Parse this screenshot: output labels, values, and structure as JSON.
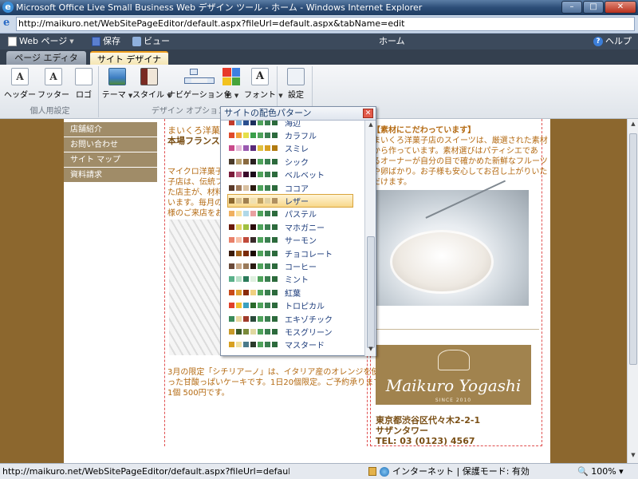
{
  "window": {
    "title": "Microsoft Office Live Small Business Web デザイン ツール - ホーム - Windows Internet Explorer",
    "buttons": {
      "minimize": "–",
      "maximize": "□",
      "close": "✕"
    }
  },
  "address": {
    "url": "http://maikuro.net/WebSitePageEditor/default.aspx?fileUrl=default.aspx&tabName=edit"
  },
  "appbar": {
    "web_page": "Web ページ",
    "save": "保存",
    "view": "ビュー",
    "page_name": "ホーム",
    "help": "ヘルプ"
  },
  "tabs": [
    {
      "label": "ページ エディタ",
      "active": false
    },
    {
      "label": "サイト デザイナ",
      "active": true
    }
  ],
  "ribbon": {
    "groups": [
      {
        "label": "個人用設定",
        "buttons": [
          {
            "label": "ヘッダー",
            "icon": "header-icon"
          },
          {
            "label": "フッター",
            "icon": "footer-icon"
          },
          {
            "label": "ロゴ",
            "icon": "logo-icon"
          }
        ]
      },
      {
        "label": "デザイン オプション",
        "buttons": [
          {
            "label": "テーマ",
            "icon": "theme-icon"
          },
          {
            "label": "スタイル",
            "icon": "style-icon"
          },
          {
            "label": "ナビゲーション",
            "icon": "navigation-icon"
          },
          {
            "label": "色",
            "icon": "color-icon"
          },
          {
            "label": "フォント",
            "icon": "font-icon"
          }
        ]
      },
      {
        "label": "",
        "buttons": [
          {
            "label": "設定",
            "icon": "settings-icon"
          }
        ]
      }
    ]
  },
  "site": {
    "nav": [
      "店舗紹介",
      "お問い合わせ",
      "サイト マップ",
      "資料請求"
    ],
    "main_heading_1": "まいくろ洋菓",
    "main_heading_2": "本場フランスの",
    "main_body": [
      "マイクロ洋菓子",
      "子店は、伝統フ",
      "た店主が、材料",
      "います。毎月の",
      "様のご来店をお"
    ],
    "main_footer": [
      "3月の限定「シチリアーノ」は、イタリア産のオレンジを使",
      "った甘酸っぱいケーキです。1日20個限定。ご予約承ります。",
      "1個 500円です。"
    ],
    "right_heading": "【素材にこだわっています】",
    "right_body": [
      "まいくろ洋菓子店のスイーツは、厳選された素材",
      "から作っています。素材選びはパティシエであ",
      "るオーナーが自分の目で確かめた新鮮なフルーツ",
      "や卵ばかり。お子様も安心してお召し上がりいた",
      "だけます。"
    ],
    "logo_text": "Maikuro Yogashi",
    "logo_since": "SINCE 2010",
    "contact": [
      "東京都渋谷区代々木2-2-1",
      "サザンタワー",
      "TEL: 03 (0123) 4567"
    ]
  },
  "popup": {
    "title": "サイトの配色パターン",
    "close": "✕",
    "selected": "レザー",
    "palettes": [
      {
        "name": "海辺",
        "colors": [
          "#c23a2a",
          "#7bb0d8",
          "#2a4f8f",
          "#1c2f5c",
          "#4fa35b",
          "#3a7f4f",
          "#2c6a3c"
        ]
      },
      {
        "name": "カラフル",
        "colors": [
          "#e04a2a",
          "#f2a33a",
          "#e5e04a",
          "#3a9f4a",
          "#4fa35b",
          "#3a7f4f",
          "#2c6a3c"
        ]
      },
      {
        "name": "スミレ",
        "colors": [
          "#c94a8a",
          "#e5b8d8",
          "#9a5ab0",
          "#5a2a7a",
          "#e0c040",
          "#d8a020",
          "#b07a10"
        ]
      },
      {
        "name": "シック",
        "colors": [
          "#4a3a2a",
          "#b8a070",
          "#8a6a40",
          "#2a2020",
          "#4fa35b",
          "#3a7f4f",
          "#2c6a3c"
        ]
      },
      {
        "name": "ベルベット",
        "colors": [
          "#7a1a3a",
          "#c26a8a",
          "#3a0a2a",
          "#1a0a1a",
          "#4fa35b",
          "#3a7f4f",
          "#2c6a3c"
        ]
      },
      {
        "name": "ココア",
        "colors": [
          "#5a3a2a",
          "#a07a5a",
          "#d8c0a0",
          "#2a1a10",
          "#4fa35b",
          "#3a7f4f",
          "#2c6a3c"
        ]
      },
      {
        "name": "レザー",
        "colors": [
          "#8c672e",
          "#d8c090",
          "#a08050",
          "#f0e0b0",
          "#c0a060",
          "#e0d0a0",
          "#b09060"
        ]
      },
      {
        "name": "パステル",
        "colors": [
          "#f0b060",
          "#f8e0a0",
          "#b0d8e8",
          "#e8a0a0",
          "#4fa35b",
          "#3a7f4f",
          "#2c6a3c"
        ]
      },
      {
        "name": "マホガニー",
        "colors": [
          "#6a1a0a",
          "#e0d060",
          "#a0c040",
          "#2a0a0a",
          "#4fa35b",
          "#3a7f4f",
          "#2c6a3c"
        ]
      },
      {
        "name": "サーモン",
        "colors": [
          "#e8806a",
          "#f8c0a8",
          "#c04a3a",
          "#3a2a2a",
          "#4fa35b",
          "#3a7f4f",
          "#2c6a3c"
        ]
      },
      {
        "name": "チョコレート",
        "colors": [
          "#3a1a0a",
          "#a0601a",
          "#7a2a0a",
          "#1a0a00",
          "#4fa35b",
          "#3a7f4f",
          "#2c6a3c"
        ]
      },
      {
        "name": "コーヒー",
        "colors": [
          "#6a4a3a",
          "#c8a888",
          "#9a7a5a",
          "#2a1a10",
          "#4fa35b",
          "#3a7f4f",
          "#2c6a3c"
        ]
      },
      {
        "name": "ミント",
        "colors": [
          "#5ab08a",
          "#b8e0c8",
          "#2a7a5a",
          "#e0f0e0",
          "#4fa35b",
          "#3a7f4f",
          "#2c6a3c"
        ]
      },
      {
        "name": "紅葉",
        "colors": [
          "#c84a1a",
          "#e0a030",
          "#8a2a0a",
          "#f0d080",
          "#4fa35b",
          "#3a7f4f",
          "#2c6a3c"
        ]
      },
      {
        "name": "トロピカル",
        "colors": [
          "#e0402a",
          "#f0c030",
          "#3aa0c0",
          "#2a6a2a",
          "#4fa35b",
          "#3a7f4f",
          "#2c6a3c"
        ]
      },
      {
        "name": "エキゾチック",
        "colors": [
          "#3a8a5a",
          "#e8d8a0",
          "#a03a2a",
          "#2a4a3a",
          "#4fa35b",
          "#3a7f4f",
          "#2c6a3c"
        ]
      },
      {
        "name": "モスグリーン",
        "colors": [
          "#c89a2a",
          "#3a5a2a",
          "#7a8a3a",
          "#e0d8a0",
          "#4fa35b",
          "#3a7f4f",
          "#2c6a3c"
        ]
      },
      {
        "name": "マスタード",
        "colors": [
          "#d8a020",
          "#f0e0a0",
          "#4a7a8a",
          "#2a3a2a",
          "#4fa35b",
          "#3a7f4f",
          "#2c6a3c"
        ]
      }
    ]
  },
  "status": {
    "url": "http://maikuro.net/WebSitePageEditor/default.aspx?fileUrl=default.aspx&tabN",
    "zone": "インターネット | 保護モード: 有効",
    "zoom": "100%"
  }
}
